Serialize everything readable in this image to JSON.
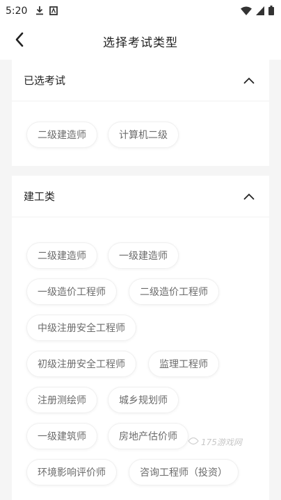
{
  "status_bar": {
    "time": "5:20",
    "icons": [
      "download-icon",
      "notification-app-icon",
      "wifi-icon",
      "signal-icon",
      "battery-icon"
    ]
  },
  "header": {
    "title": "选择考试类型",
    "back_icon": "back-arrow-icon"
  },
  "selected_section": {
    "title": "已选考试",
    "toggle_icon": "chevron-up-icon",
    "chips": [
      "二级建造师",
      "计算机二级"
    ]
  },
  "construction_section": {
    "title": "建工类",
    "toggle_icon": "chevron-up-icon",
    "chips": [
      "二级建造师",
      "一级建造师",
      "一级造价工程师",
      "二级造价工程师",
      "中级注册安全工程师",
      "初级注册安全工程师",
      "监理工程师",
      "注册测绘师",
      "城乡规划师",
      "一级建筑师",
      "房地产估价师",
      "环境影响评价师",
      "咨询工程师（投资）"
    ]
  },
  "watermark": {
    "text": "175游戏网"
  },
  "colors": {
    "background": "#f5f5f5",
    "card": "#ffffff",
    "chip_text": "#6b6b6b",
    "title_text": "#222222"
  }
}
